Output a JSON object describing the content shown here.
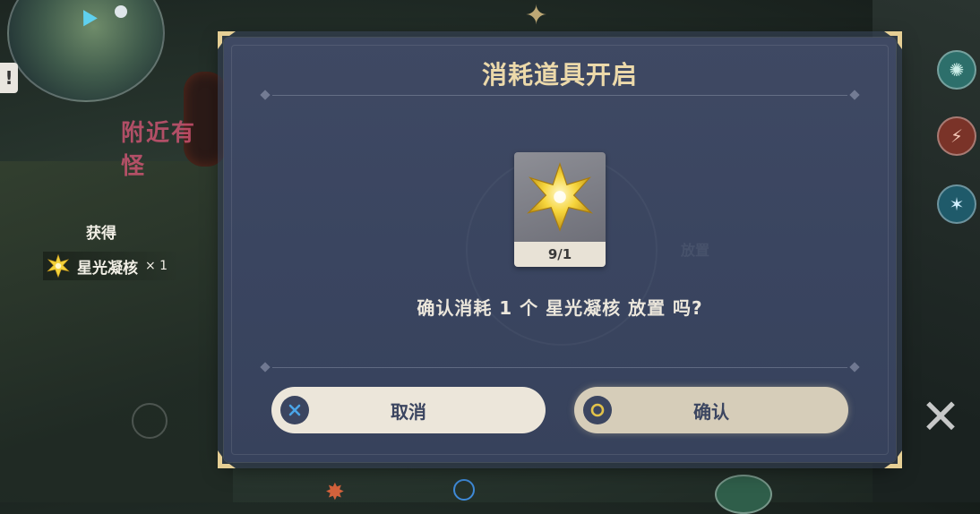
{
  "hud": {
    "quest_mark": "!",
    "acquire_title": "获得",
    "acquire_item_name": "星光凝核",
    "acquire_item_count": "× 1",
    "bg_pink_sign": "附近有怪"
  },
  "dialog": {
    "title": "消耗道具开启",
    "item_count": "9/1",
    "confirm_message": "确认消耗 1 个 星光凝核 放置 吗?",
    "ghost_label": "放置",
    "cancel_label": "取消",
    "ok_label": "确认"
  },
  "icons": {
    "cancel": "x-icon",
    "ok": "circle-icon",
    "item": "starlight-core-icon"
  },
  "colors": {
    "title": "#ecd9aa",
    "dialog_bg": "#3a4560",
    "cancel_btn": "#ece6da",
    "ok_btn": "#d6cdb9",
    "cancel_x": "#4aa5e8",
    "ok_ring": "#e2c24a",
    "star_gold": "#f3d23a"
  }
}
